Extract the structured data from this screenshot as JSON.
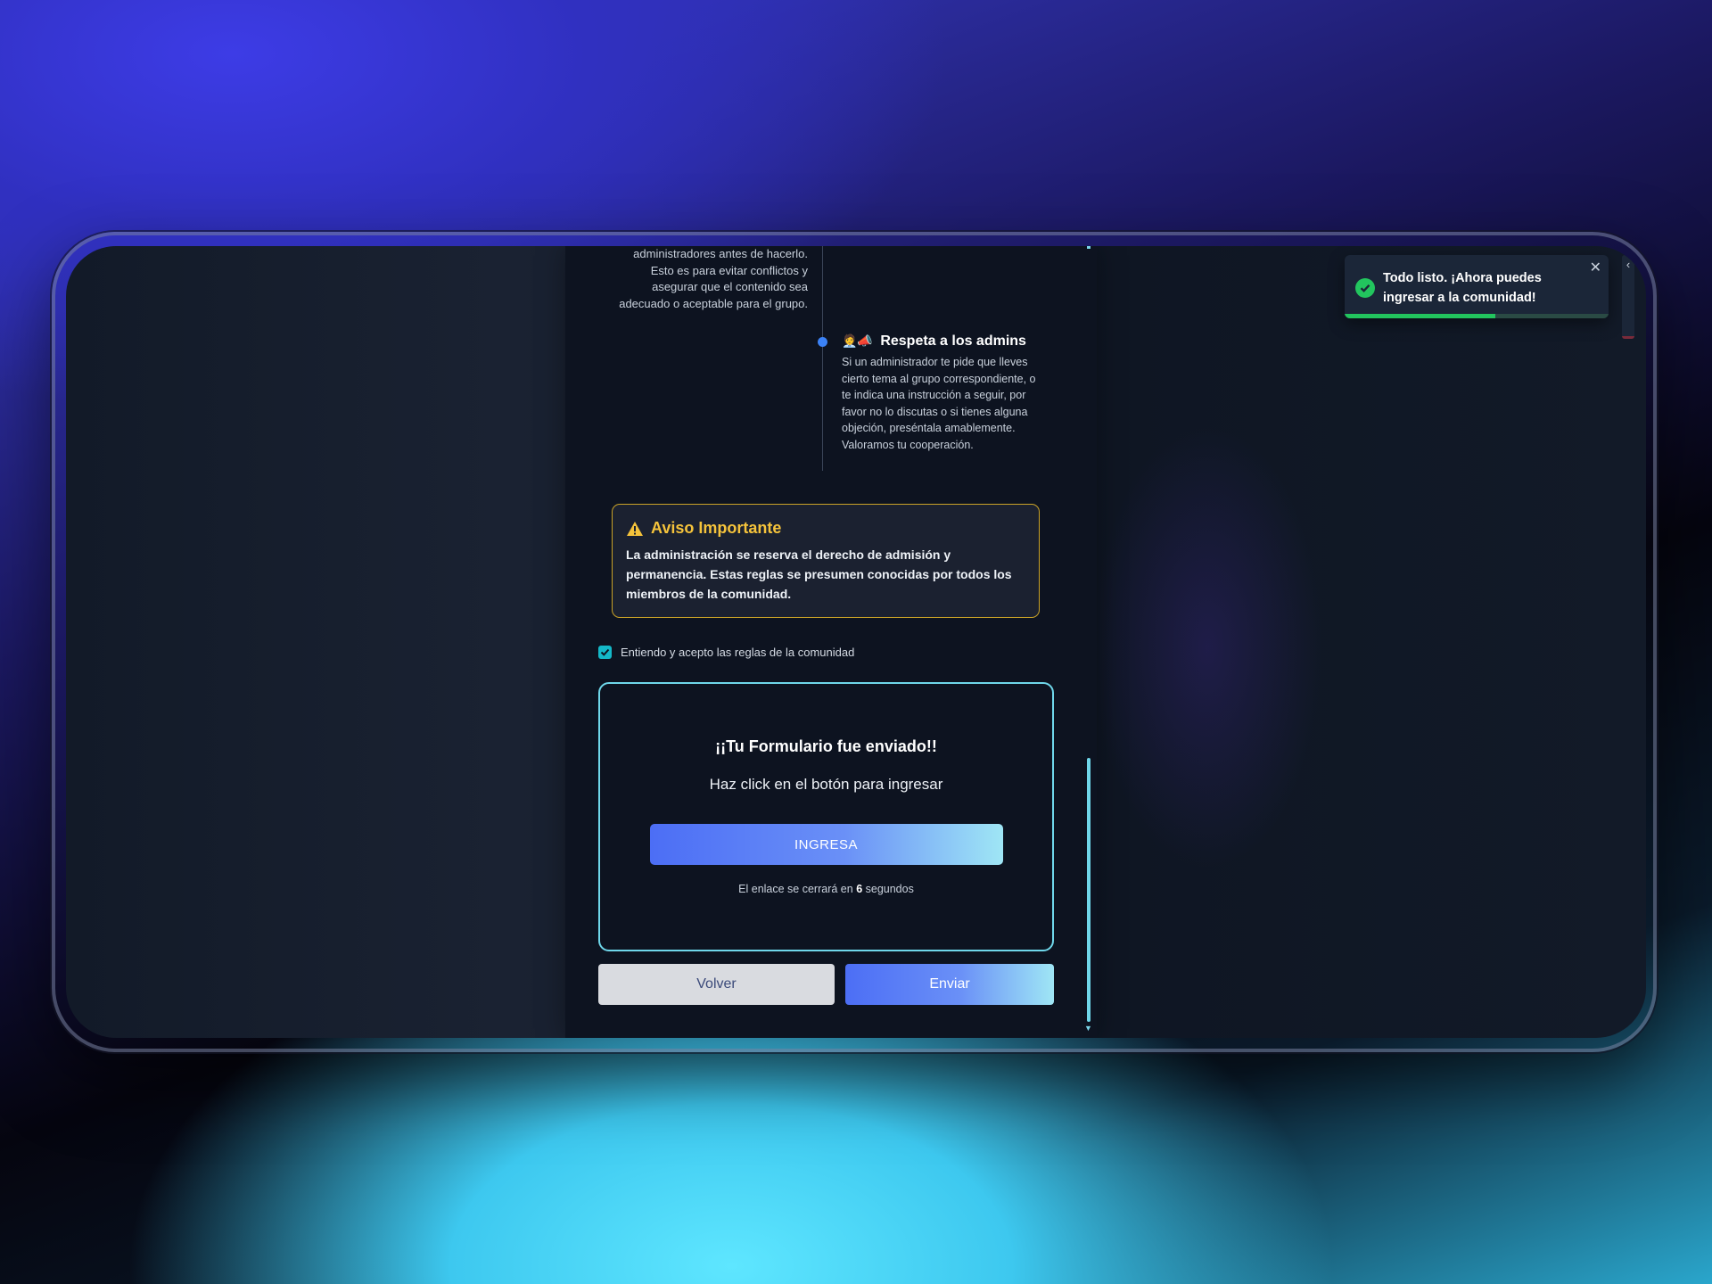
{
  "rules": {
    "previous_rule_text": [
      "administradores antes de hacerlo.",
      "Esto es para evitar conflictos y",
      "asegurar que el contenido sea",
      "adecuado o aceptable para el grupo."
    ],
    "current_rule": {
      "icons": "🧑‍💼📣",
      "title": "Respeta a los admins",
      "body": "Si un administrador te pide que lleves cierto tema al grupo correspondiente, o te indica una instrucción a seguir, por favor no lo discutas o si tienes alguna objeción, preséntala amablemente. Valoramos tu cooperación."
    }
  },
  "warning": {
    "title": "Aviso Importante",
    "text": "La administración se reserva el derecho de admisión y permanencia. Estas reglas se presumen conocidas por todos los miembros de la comunidad.",
    "border_color": "#c9a227",
    "title_color": "#f5c33b"
  },
  "accept": {
    "checked": true,
    "label": "Entiendo y acepto las reglas de la comunidad"
  },
  "success": {
    "title": "¡¡Tu Formulario fue enviado!!",
    "subtitle": "Haz click en el botón para ingresar",
    "button_label": "INGRESA",
    "countdown_prefix": "El enlace se cerrará en",
    "countdown_value": "6",
    "countdown_suffix": "segundos"
  },
  "actions": {
    "back_label": "Volver",
    "submit_label": "Enviar"
  },
  "toast": {
    "icon": "check-circle-icon",
    "message": "Todo listo. ¡Ahora puedes ingresar a la comunidad!",
    "close_glyph": "✕",
    "progress": 0.57,
    "color": "#22c55e"
  },
  "side_tab": {
    "glyph": "‹"
  }
}
